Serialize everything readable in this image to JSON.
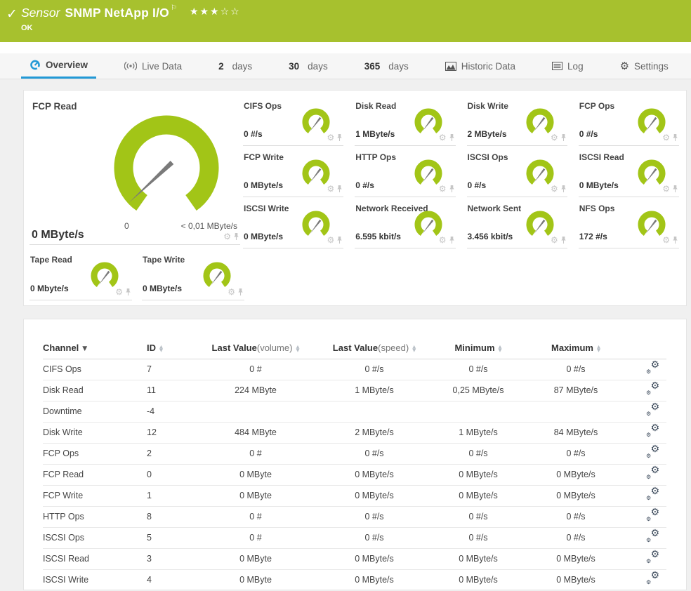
{
  "colors": {
    "brand_green": "#a7c12e",
    "gauge_green": "#a2c517",
    "accent_blue": "#2299d6",
    "needle_gray": "#7a7a7a"
  },
  "icons": {
    "check": "✓",
    "flag": "⚐",
    "gear": "⚙",
    "sort_asc": "▲",
    "sort_desc": "▼"
  },
  "header": {
    "kicker": "Sensor",
    "title": "SNMP NetApp I/O",
    "stars": "★★★☆☆",
    "status": "OK"
  },
  "tabs": {
    "overview": {
      "label": "Overview"
    },
    "live": {
      "label": "Live Data"
    },
    "d2": {
      "num": "2",
      "unit": "days"
    },
    "d30": {
      "num": "30",
      "unit": "days"
    },
    "d365": {
      "num": "365",
      "unit": "days"
    },
    "historic": {
      "label": "Historic Data"
    },
    "log": {
      "label": "Log"
    },
    "settings": {
      "label": "Settings"
    }
  },
  "featured_gauge": {
    "title": "FCP Read",
    "value": "0 MByte/s",
    "scale_min": "0",
    "scale_max": "< 0,01 MByte/s"
  },
  "small_gauges": [
    {
      "title": "CIFS Ops",
      "value": "0 #/s"
    },
    {
      "title": "Disk Read",
      "value": "1 MByte/s"
    },
    {
      "title": "Disk Write",
      "value": "2 MByte/s"
    },
    {
      "title": "FCP Ops",
      "value": "0 #/s"
    },
    {
      "title": "FCP Write",
      "value": "0 MByte/s"
    },
    {
      "title": "HTTP Ops",
      "value": "0 #/s"
    },
    {
      "title": "ISCSI Ops",
      "value": "0 #/s"
    },
    {
      "title": "ISCSI Read",
      "value": "0 MByte/s"
    },
    {
      "title": "ISCSI Write",
      "value": "0 MByte/s"
    },
    {
      "title": "Network Received",
      "value": "6.595 kbit/s"
    },
    {
      "title": "Network Sent",
      "value": "3.456 kbit/s"
    },
    {
      "title": "NFS Ops",
      "value": "172 #/s"
    }
  ],
  "tape_gauges": [
    {
      "title": "Tape Read",
      "value": "0 Mbyte/s"
    },
    {
      "title": "Tape Write",
      "value": "0 MByte/s"
    }
  ],
  "table": {
    "columns": {
      "channel": "Channel",
      "id": "ID",
      "vol": "Last Value",
      "vol_qual": "(volume)",
      "speed": "Last Value",
      "speed_qual": "(speed)",
      "min": "Minimum",
      "max": "Maximum"
    },
    "rows": [
      {
        "channel": "CIFS Ops",
        "id": "7",
        "vol": "0 #",
        "speed": "0 #/s",
        "min": "0 #/s",
        "max": "0 #/s"
      },
      {
        "channel": "Disk Read",
        "id": "11",
        "vol": "224 MByte",
        "speed": "1 MByte/s",
        "min": "0,25 MByte/s",
        "max": "87 MByte/s"
      },
      {
        "channel": "Downtime",
        "id": "-4",
        "vol": "",
        "speed": "",
        "min": "",
        "max": ""
      },
      {
        "channel": "Disk Write",
        "id": "12",
        "vol": "484 MByte",
        "speed": "2 MByte/s",
        "min": "1 MByte/s",
        "max": "84 MByte/s"
      },
      {
        "channel": "FCP Ops",
        "id": "2",
        "vol": "0 #",
        "speed": "0 #/s",
        "min": "0 #/s",
        "max": "0 #/s"
      },
      {
        "channel": "FCP Read",
        "id": "0",
        "vol": "0 MByte",
        "speed": "0 MByte/s",
        "min": "0 MByte/s",
        "max": "0 MByte/s"
      },
      {
        "channel": "FCP Write",
        "id": "1",
        "vol": "0 MByte",
        "speed": "0 MByte/s",
        "min": "0 MByte/s",
        "max": "0 MByte/s"
      },
      {
        "channel": "HTTP Ops",
        "id": "8",
        "vol": "0 #",
        "speed": "0 #/s",
        "min": "0 #/s",
        "max": "0 #/s"
      },
      {
        "channel": "ISCSI Ops",
        "id": "5",
        "vol": "0 #",
        "speed": "0 #/s",
        "min": "0 #/s",
        "max": "0 #/s"
      },
      {
        "channel": "ISCSI Read",
        "id": "3",
        "vol": "0 MByte",
        "speed": "0 MByte/s",
        "min": "0 MByte/s",
        "max": "0 MByte/s"
      },
      {
        "channel": "ISCSI Write",
        "id": "4",
        "vol": "0 MByte",
        "speed": "0 MByte/s",
        "min": "0 MByte/s",
        "max": "0 MByte/s"
      }
    ]
  }
}
